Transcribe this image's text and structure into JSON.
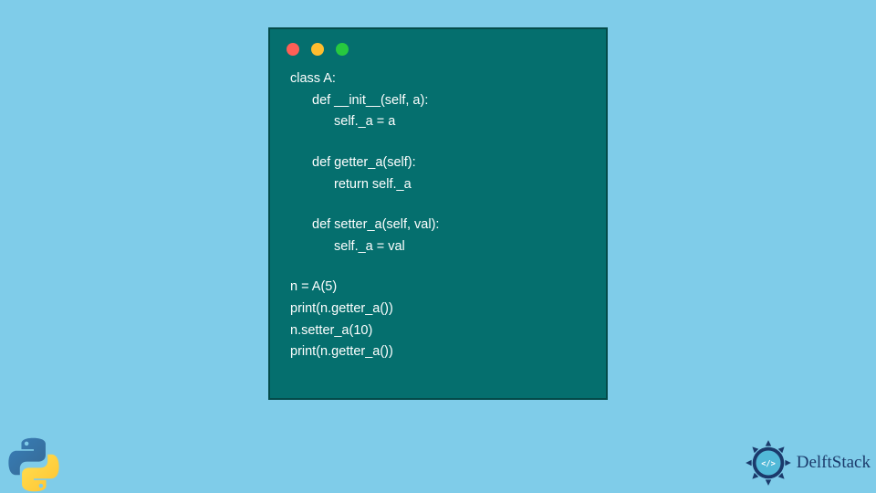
{
  "code": {
    "line1": "class A:",
    "line2": "def __init__(self, a):",
    "line3": "self._a = a",
    "line4": "def getter_a(self):",
    "line5": "return self._a",
    "line6": "def setter_a(self, val):",
    "line7": "self._a = val",
    "line8": "n = A(5)",
    "line9": "print(n.getter_a())",
    "line10": "n.setter_a(10)",
    "line11": "print(n.getter_a())"
  },
  "brand": {
    "name": "DelftStack"
  },
  "colors": {
    "background": "#7fcce9",
    "window": "#056f6e",
    "dot_red": "#ff5f56",
    "dot_yellow": "#ffbd2e",
    "dot_green": "#27c93f"
  }
}
